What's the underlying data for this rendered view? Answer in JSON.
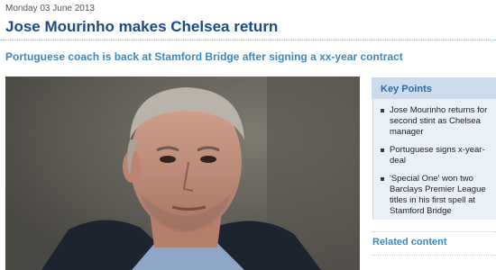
{
  "article": {
    "date": "Monday 03 June 2013",
    "headline": "Jose Mourinho makes Chelsea return",
    "subheadline": "Portuguese coach is back at Stamford Bridge after signing a xx-year contract"
  },
  "photo": {
    "icon": "photo-of-man-in-dark-coat"
  },
  "key_points": {
    "title": "Key Points",
    "items": [
      "Jose Mourinho returns for second stint as Chelsea manager",
      "Portuguese signs x-year-deal",
      "'Special One' won two Barclays Premier League titles in his first spell at Stamford Bridge"
    ]
  },
  "related": {
    "label": "Related content"
  },
  "colors": {
    "headline": "#1d4a86",
    "subhead": "#3b88c4",
    "sidebar_bg": "#eaf0f7",
    "sidebar_header": "#cddcec"
  }
}
